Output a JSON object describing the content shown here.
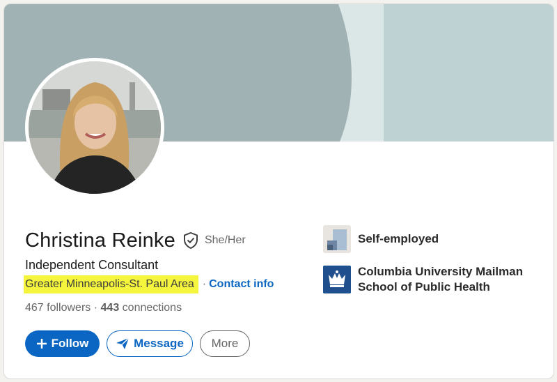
{
  "profile": {
    "name": "Christina Reinke",
    "pronouns": "She/Her",
    "headline": "Independent Consultant",
    "location": "Greater Minneapolis-St. Paul Area",
    "separator": "·",
    "contact_info": "Contact info",
    "followers_count": "467 followers",
    "connections_count": "443",
    "connections_label": "connections"
  },
  "actions": {
    "follow_label": "Follow",
    "message_label": "Message",
    "more_label": "More"
  },
  "experience": {
    "current_org": "Self-employed",
    "education_line1": "Columbia University Mailman",
    "education_line2": "School of Public Health"
  },
  "icons": {
    "verified": "shield-check-icon",
    "follow": "plus-icon",
    "message": "paper-plane-icon",
    "org": "company-logo-icon",
    "school": "crown-logo-icon"
  },
  "colors": {
    "accent": "#0a66c2",
    "banner_dark": "#a1b2b5",
    "banner_light": "#bfd2d3",
    "highlight": "#f5f53d"
  }
}
